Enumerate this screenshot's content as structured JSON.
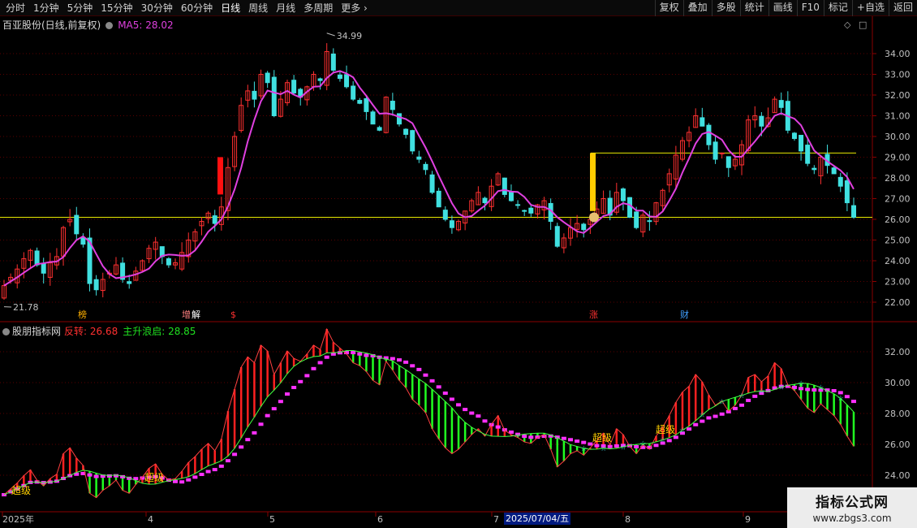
{
  "toolbar": {
    "periods": [
      "分时",
      "1分钟",
      "5分钟",
      "15分钟",
      "30分钟",
      "60分钟",
      "日线",
      "周线",
      "月线",
      "多周期",
      "更多"
    ],
    "active_period": "日线",
    "right_buttons": [
      "复权",
      "叠加",
      "多股",
      "统计",
      "画线",
      "F10",
      "标记",
      "+自选",
      "返回"
    ]
  },
  "main_panel": {
    "title": "百亚股份(日线,前复权)",
    "ma_label": "MA5: 28.02",
    "high_label": "34.99",
    "low_label": "21.78",
    "price_ticks": [
      "34.00",
      "33.00",
      "32.00",
      "31.00",
      "30.00",
      "29.00",
      "28.00",
      "27.00",
      "26.00",
      "25.00",
      "24.00",
      "23.00",
      "22.00"
    ],
    "markers": [
      "榜",
      "增",
      "解",
      "$",
      "涨",
      "财"
    ],
    "colors": {
      "up": "#ff3030",
      "down": "#40e0e0",
      "ma": "#e040e0",
      "level_line": "#e8e800"
    }
  },
  "indicator_panel": {
    "name": "股朋指标网",
    "field1": "反转: 26.68",
    "field2": "主升浪启: 28.85",
    "ticks": [
      "32.00",
      "30.00",
      "28.00",
      "26.00",
      "24.00"
    ],
    "signal_label": "超级",
    "colors": {
      "red_bars": "#ff2020",
      "green_bars": "#20ff20",
      "magenta": "#ff30ff",
      "cyan": "#40e0e0"
    }
  },
  "time_axis": {
    "labels": [
      "2025年",
      "4",
      "5",
      "6",
      "7",
      "8",
      "9"
    ],
    "cursor_date": "2025/07/04/五"
  },
  "watermark": {
    "line1": "指标公式网",
    "line2": "www.zbgs3.com"
  },
  "chart_data": {
    "type": "candlestick",
    "price_range": [
      21.5,
      35.0
    ],
    "high": 34.99,
    "low": 21.78,
    "ma5_last": 28.02,
    "horizontal_levels": [
      29.2,
      26.1
    ],
    "closes": [
      22.8,
      23.2,
      23.6,
      24.1,
      24.5,
      23.8,
      23.4,
      23.9,
      24.2,
      25.6,
      26.0,
      25.3,
      24.8,
      22.9,
      22.6,
      23.1,
      23.4,
      23.8,
      23.1,
      22.9,
      23.5,
      24.0,
      24.6,
      24.9,
      24.2,
      23.8,
      23.9,
      24.4,
      25.0,
      25.4,
      25.9,
      26.3,
      25.8,
      26.6,
      28.5,
      30.0,
      31.5,
      32.2,
      31.8,
      33.0,
      32.6,
      31.0,
      31.8,
      32.6,
      32.1,
      31.9,
      32.4,
      33.0,
      32.7,
      34.1,
      33.2,
      32.8,
      32.4,
      31.8,
      31.6,
      31.2,
      30.6,
      30.3,
      31.9,
      31.3,
      30.6,
      30.1,
      29.3,
      28.9,
      28.4,
      27.3,
      26.6,
      26.0,
      25.6,
      25.9,
      26.4,
      26.9,
      27.3,
      26.8,
      27.6,
      28.2,
      27.2,
      26.9,
      26.7,
      26.4,
      26.3,
      26.7,
      26.9,
      25.9,
      24.7,
      25.1,
      25.6,
      25.8,
      25.5,
      26.0,
      26.5,
      27.0,
      26.2,
      27.3,
      26.9,
      26.1,
      25.6,
      26.2,
      25.9,
      26.8,
      27.4,
      28.2,
      29.1,
      29.8,
      30.2,
      31.0,
      30.5,
      29.6,
      28.9,
      29.2,
      28.5,
      28.9,
      29.6,
      30.8,
      31.0,
      30.5,
      30.9,
      31.8,
      31.4,
      30.3,
      29.9,
      29.3,
      28.7,
      28.4,
      29.0,
      28.6,
      28.2,
      27.6,
      26.8,
      26.1
    ]
  }
}
